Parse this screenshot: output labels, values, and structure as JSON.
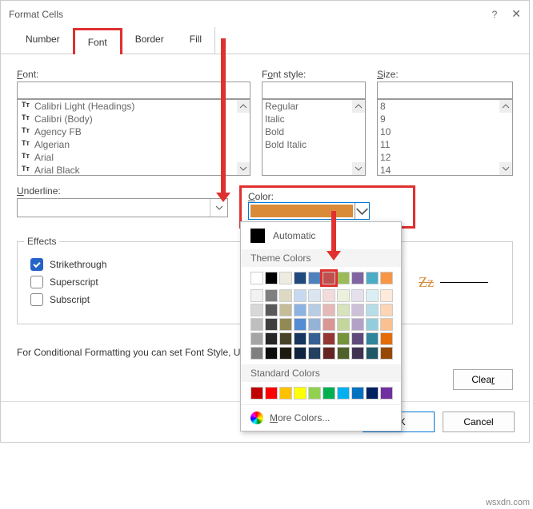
{
  "titlebar": {
    "title": "Format Cells"
  },
  "tabs": {
    "number": "Number",
    "font": "Font",
    "border": "Border",
    "fill": "Fill"
  },
  "font": {
    "label": "Font:",
    "items": [
      "Calibri Light (Headings)",
      "Calibri (Body)",
      "Agency FB",
      "Algerian",
      "Arial",
      "Arial Black"
    ]
  },
  "fontstyle": {
    "label": "Font style:",
    "items": [
      "Regular",
      "Italic",
      "Bold",
      "Bold Italic"
    ]
  },
  "size": {
    "label": "Size:",
    "items": [
      "8",
      "9",
      "10",
      "11",
      "12",
      "14"
    ]
  },
  "underline": {
    "label": "Underline:"
  },
  "color": {
    "label": "Color:",
    "selected_hex": "#d98b3a",
    "popup": {
      "automatic": "Automatic",
      "theme_head": "Theme Colors",
      "theme_row": [
        "#ffffff",
        "#000000",
        "#eeece1",
        "#1f497d",
        "#4f81bd",
        "#c0504d",
        "#9bbb59",
        "#8064a2",
        "#4bacc6",
        "#f79646"
      ],
      "theme_tints": [
        [
          "#f2f2f2",
          "#7f7f7f",
          "#ddd9c3",
          "#c6d9f0",
          "#dbe5f1",
          "#f2dcdb",
          "#ebf1dd",
          "#e5e0ec",
          "#dbeef3",
          "#fdeada"
        ],
        [
          "#d8d8d8",
          "#595959",
          "#c4bd97",
          "#8db3e2",
          "#b8cce4",
          "#e5b9b7",
          "#d7e3bc",
          "#ccc1d9",
          "#b7dde8",
          "#fbd5b5"
        ],
        [
          "#bfbfbf",
          "#3f3f3f",
          "#938953",
          "#548dd4",
          "#95b3d7",
          "#d99694",
          "#c3d69b",
          "#b2a2c7",
          "#92cddc",
          "#fac08f"
        ],
        [
          "#a5a5a5",
          "#262626",
          "#494429",
          "#17365d",
          "#366092",
          "#953734",
          "#76923c",
          "#5f497a",
          "#31859b",
          "#e36c09"
        ],
        [
          "#7f7f7f",
          "#0c0c0c",
          "#1d1b10",
          "#0f243e",
          "#244061",
          "#632423",
          "#4f6128",
          "#3f3151",
          "#205867",
          "#974806"
        ]
      ],
      "standard_head": "Standard Colors",
      "standard": [
        "#c00000",
        "#ff0000",
        "#ffc000",
        "#ffff00",
        "#92d050",
        "#00b050",
        "#00b0f0",
        "#0070c0",
        "#002060",
        "#7030a0"
      ],
      "more_colors": "More Colors..."
    }
  },
  "effects": {
    "legend": "Effects",
    "strike": "Strikethrough",
    "sup": "Superscript",
    "sub": "Subscript"
  },
  "preview": {
    "sample": "Zz"
  },
  "note": "For Conditional Formatting you can set Font Style, Underline, Color, and Strikethrough.",
  "buttons": {
    "clear": "Clear",
    "ok": "OK",
    "cancel": "Cancel"
  },
  "watermark": "wsxdn.com"
}
